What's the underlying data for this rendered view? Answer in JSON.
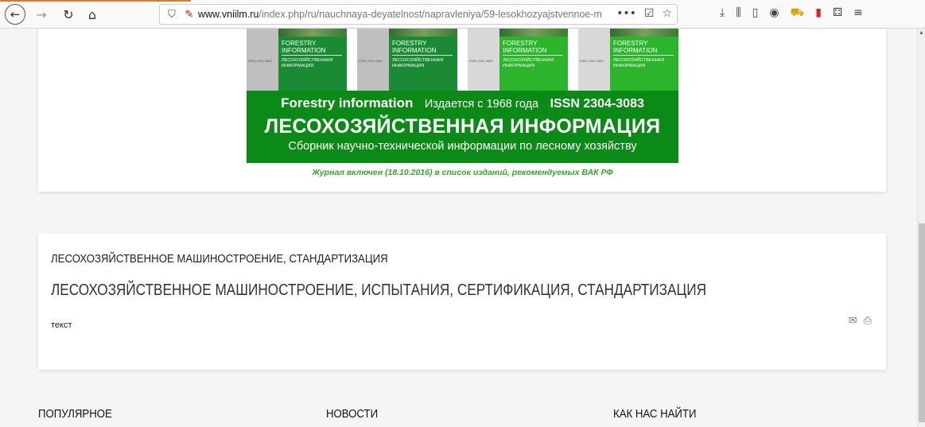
{
  "browser": {
    "url_domain": "www.vniilm.ru",
    "url_path": "/index.php/ru/nauchnaya-deyatelnost/napravleniya/59-lesokhozyajstvennoe-m",
    "back_glyph": "←",
    "forward_glyph": "→",
    "reload_glyph": "↻",
    "home_glyph": "⌂",
    "shield_glyph": "⛉",
    "lock_glyph": "✎",
    "more_glyph": "•••",
    "pocket_glyph": "☑",
    "star_glyph": "☆",
    "download_glyph": "⤓",
    "library_glyph": "⫼",
    "sidebar_glyph": "▯",
    "account_glyph": "◉",
    "cart_glyph": "⛟",
    "flag_glyph": "▮",
    "ext_glyph": "⚃",
    "menu_glyph": "≡",
    "scroll_up_glyph": "▲",
    "accent_color": "#d97a2a"
  },
  "banner": {
    "covers": [
      {
        "title": "FORESTRY\nINFORMATION",
        "subtitle": "ЛЕСОХОЗЯЙСТВЕННАЯ\nИНФОРМАЦИЯ",
        "issn": "ISSN 2304-3083"
      },
      {
        "title": "FORESTRY\nINFORMATION",
        "subtitle": "ЛЕСОХОЗЯЙСТВЕННАЯ\nИНФОРМАЦИЯ",
        "issn": "ISSN 2304-3083"
      },
      {
        "title": "FORESTRY\nINFORMATION",
        "subtitle": "ЛЕСОХОЗЯЙСТВЕННАЯ\nИНФОРМАЦИЯ",
        "issn": "ISSN 2304-3083"
      },
      {
        "title": "FORESTRY\nINFORMATION",
        "subtitle": "ЛЕСОХОЗЯЙСТВЕННАЯ\nИНФОРМАЦИЯ",
        "issn": "ISSN 2304-3083"
      }
    ],
    "en_title": "Forestry information",
    "since": "Издается с 1968 года",
    "issn": "ISSN 2304-3083",
    "ru_title": "ЛЕСОХОЗЯЙСТВЕННАЯ ИНФОРМАЦИЯ",
    "description": "Сборник научно-технической информации по лесному хозяйству",
    "vak_note": "Журнал   включен (18.10.2016) в список изданий, рекомендуемых ВАК РФ",
    "green_color": "#0b8a17"
  },
  "article": {
    "category": "ЛЕСОХОЗЯЙСТВЕННОЕ МАШИНОСТРОЕНИЕ, СТАНДАРТИЗАЦИЯ",
    "title": "ЛЕСОХОЗЯЙСТВЕННОЕ МАШИНОСТРОЕНИЕ, ИСПЫТАНИЯ, СЕРТИФИКАЦИЯ, СТАНДАРТИЗАЦИЯ",
    "text": "текст",
    "email_glyph": "✉",
    "print_glyph": "⎙"
  },
  "footer": {
    "popular": "ПОПУЛЯРНОЕ",
    "news": "НОВОСТИ",
    "find_us": "КАК НАС НАЙТИ"
  }
}
